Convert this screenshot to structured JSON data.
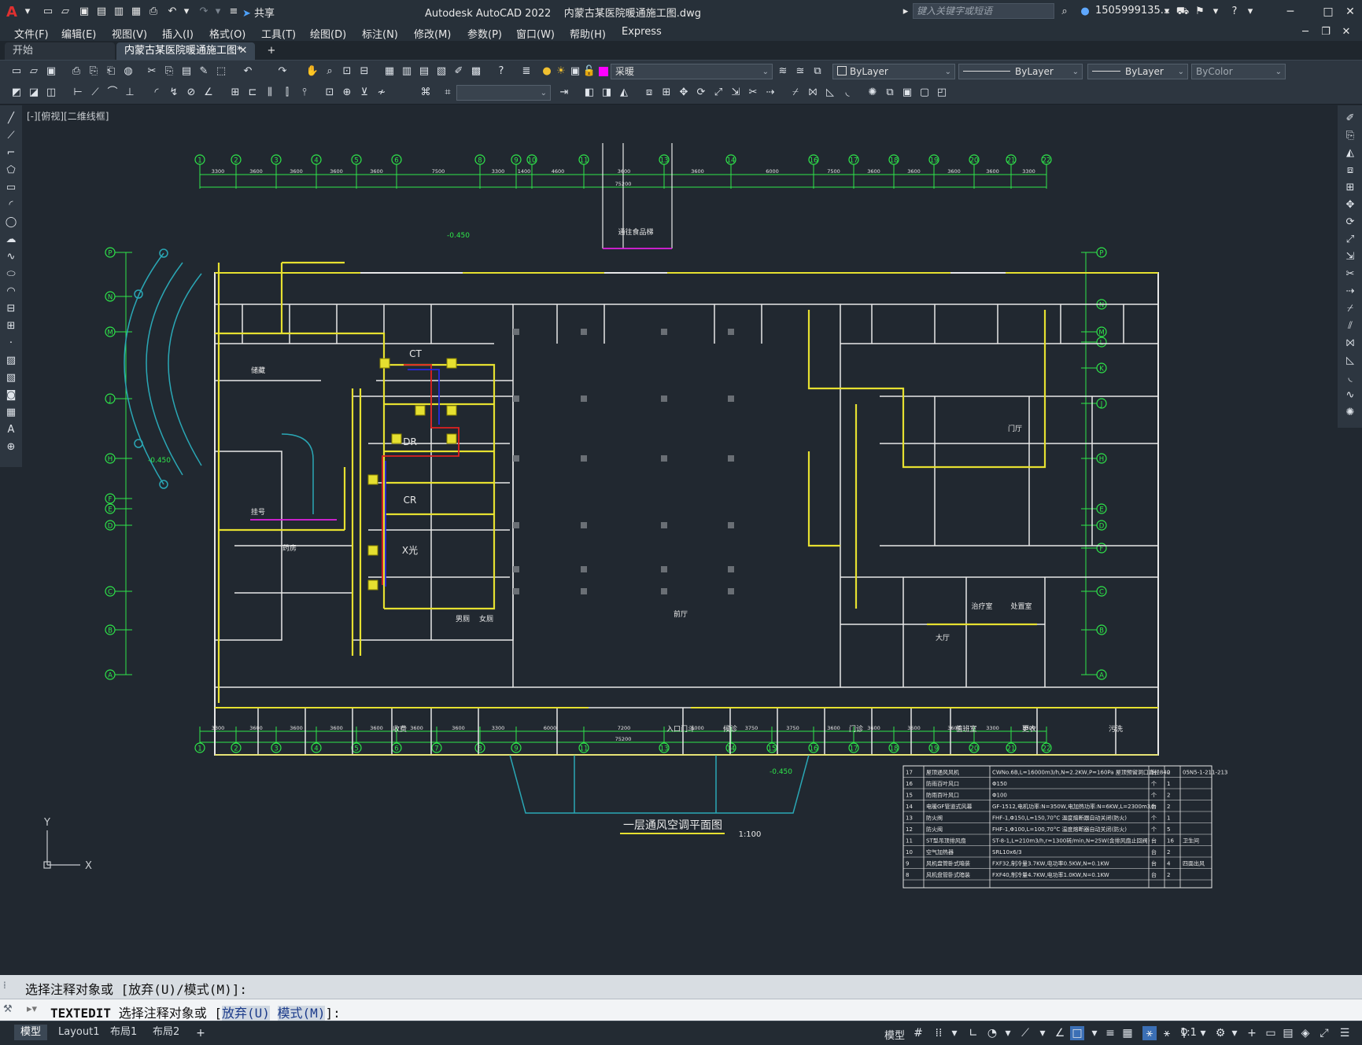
{
  "titlebar": {
    "app_title": "Autodesk AutoCAD 2022",
    "file_name": "内蒙古某医院暖通施工图.dwg",
    "share_label": "共享",
    "search_placeholder": "键入关键字或短语",
    "user_name": "1505999135..."
  },
  "menu": [
    "文件(F)",
    "编辑(E)",
    "视图(V)",
    "插入(I)",
    "格式(O)",
    "工具(T)",
    "绘图(D)",
    "标注(N)",
    "修改(M)",
    "参数(P)",
    "窗口(W)",
    "帮助(H)",
    "Express"
  ],
  "tabs": {
    "start": "开始",
    "document": "内蒙古某医院暖通施工图*",
    "add": "+"
  },
  "layer_dropdown": "采暖",
  "properties": {
    "color": "ByLayer",
    "linetype": "ByLayer",
    "lineweight": "ByLayer",
    "plotstyle": "ByColor"
  },
  "viewport_label": "[-][俯视][二维线框]",
  "drawing": {
    "title": "一层通风空调平面图",
    "scale": "1:100",
    "column_labels": [
      "1",
      "2",
      "3",
      "4",
      "5",
      "6",
      "8",
      "9",
      "10",
      "11",
      "13",
      "14",
      "16",
      "17",
      "18",
      "19",
      "20",
      "21",
      "22"
    ],
    "column_labels_bottom": [
      "1",
      "2",
      "3",
      "4",
      "5",
      "6",
      "7",
      "8",
      "9",
      "11",
      "13",
      "14",
      "15",
      "16",
      "17",
      "18",
      "19",
      "20",
      "21",
      "22"
    ],
    "row_labels_left": [
      "P",
      "N",
      "M",
      "J",
      "H",
      "F",
      "E",
      "D",
      "C",
      "B",
      "A"
    ],
    "row_labels_right": [
      "P",
      "N",
      "M",
      "L",
      "K",
      "J",
      "H",
      "E",
      "D",
      "F",
      "C",
      "B",
      "A"
    ],
    "top_dims": [
      "3300",
      "3600",
      "3600",
      "3600",
      "3600",
      "7500",
      "3300",
      "1400",
      "4600",
      "3600",
      "3600",
      "6000",
      "7500",
      "3600",
      "3600",
      "3600",
      "3600",
      "3300",
      "3300"
    ],
    "bottom_dims": [
      "3300",
      "3600",
      "3600",
      "3600",
      "3600",
      "3600",
      "3600",
      "3300",
      "6000",
      "7200",
      "6000",
      "3750",
      "3750",
      "3600",
      "3600",
      "3600",
      "3600",
      "3300",
      "3300"
    ],
    "total_dim": "75200",
    "rooms": [
      "前厅",
      "入口门斗",
      "门厅",
      "通往食品梯",
      "挂号",
      "药房",
      "收费",
      "大厅",
      "候诊",
      "门诊",
      "储藏",
      "男厕",
      "女厕",
      "治疗室",
      "处置室",
      "值班室",
      "更衣",
      "污洗"
    ],
    "labels": [
      "CT",
      "DR",
      "CR",
      "X光"
    ],
    "elevations": [
      "-0.450",
      "-0.450",
      "-0.450"
    ]
  },
  "equipment_table": [
    {
      "no": "17",
      "name": "屋顶通风风机",
      "spec": "CWNo.6B,L=16000m3/h,N=2.2KW,P=160Pa 屋顶预留洞口直径840",
      "unit": "台",
      "qty": "2",
      "note": "05N5-1-211-213"
    },
    {
      "no": "16",
      "name": "防雨百叶风口",
      "spec": "Φ150",
      "unit": "个",
      "qty": "1",
      "note": ""
    },
    {
      "no": "15",
      "name": "防雨百叶风口",
      "spec": "Φ100",
      "unit": "个",
      "qty": "2",
      "note": ""
    },
    {
      "no": "14",
      "name": "电暖GF管道式风幕",
      "spec": "GF-1512,电机功率:N=350W,电加热功率:N=6KW,L=2300m3/h",
      "unit": "台",
      "qty": "2",
      "note": ""
    },
    {
      "no": "13",
      "name": "防火阀",
      "spec": "FHF-1,Φ150,L=150,70°C 温度熔断器自动关闭(防火)",
      "unit": "个",
      "qty": "1",
      "note": ""
    },
    {
      "no": "12",
      "name": "防火阀",
      "spec": "FHF-1,Φ100,L=100,70°C 温度熔断器自动关闭(防火)",
      "unit": "个",
      "qty": "5",
      "note": ""
    },
    {
      "no": "11",
      "name": "ST型吊顶排风扇",
      "spec": "ST-8-1,L=210m3/h,r=1300转/min,N=25W(含排风扇止回阀)",
      "unit": "台",
      "qty": "16",
      "note": "卫生间"
    },
    {
      "no": "10",
      "name": "空气加热器",
      "spec": "SRL10x6/3",
      "unit": "台",
      "qty": "2",
      "note": ""
    },
    {
      "no": "9",
      "name": "风机盘管卧式暗装",
      "spec": "FXF32,制冷量3.7KW,电功率0.5KW,N=0.1KW",
      "unit": "台",
      "qty": "4",
      "note": "四面出风"
    },
    {
      "no": "8",
      "name": "风机盘管卧式暗装",
      "spec": "FXF40,制冷量4.7KW,电功率1.0KW,N=0.1KW",
      "unit": "台",
      "qty": "2",
      "note": ""
    }
  ],
  "command": {
    "history": "选择注释对象或 [放弃(U)/模式(M)]:",
    "name": "TEXTEDIT",
    "prompt": "选择注释对象或 [",
    "opt1": "放弃(U)",
    "opt2": "模式(M)",
    "end": "]:"
  },
  "layout_tabs": [
    "模型",
    "Layout1",
    "布局1",
    "布局2"
  ],
  "status": {
    "model_label": "模型",
    "scale": "1:1"
  },
  "colors": {
    "wall": "#e8e8e8",
    "grid": "#2ee64a",
    "duct": "#e6e030",
    "stair": "#2aa7b5",
    "red": "#e02020",
    "blue": "#2828e0",
    "magenta": "#e020e0"
  }
}
